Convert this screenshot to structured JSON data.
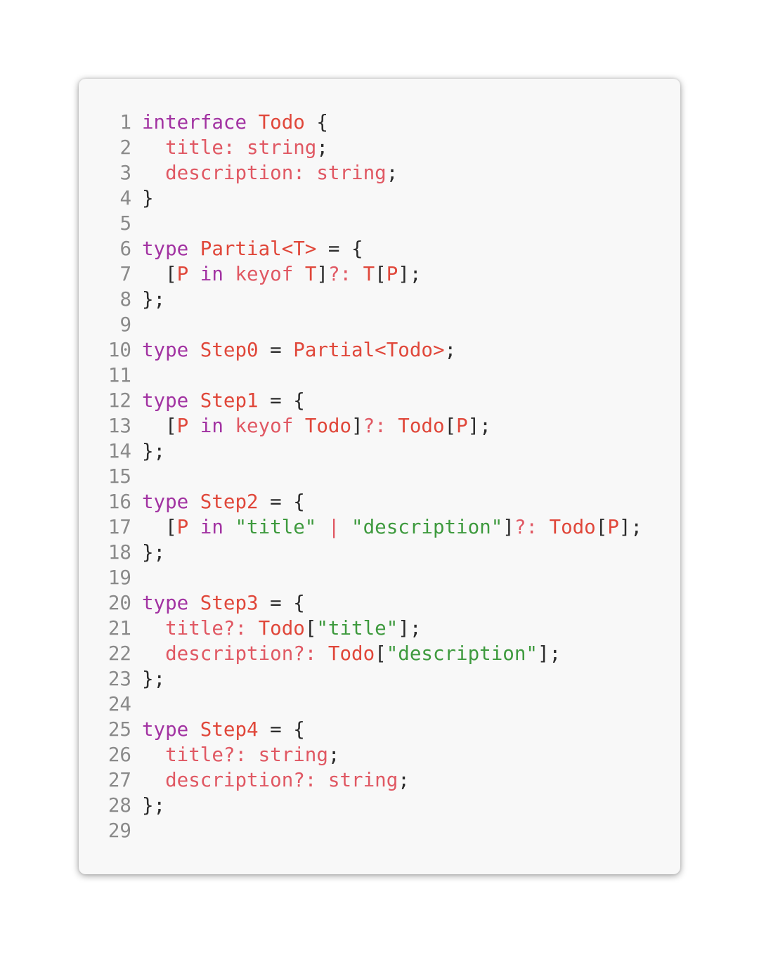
{
  "colors": {
    "card_background": "#f8f8f8",
    "punctuation": "#2b2b2b",
    "keyword": "#a233a2",
    "type_name": "#e0473a",
    "property": "#e05863",
    "string": "#3e9a3e",
    "line_number": "#8a8a8a"
  },
  "code": {
    "language": "typescript",
    "lines": [
      {
        "n": "1",
        "tokens": [
          {
            "t": "kw",
            "v": "interface "
          },
          {
            "t": "ty",
            "v": "Todo"
          },
          {
            "t": "p",
            "v": " {"
          }
        ]
      },
      {
        "n": "2",
        "tokens": [
          {
            "t": "p",
            "v": "  "
          },
          {
            "t": "pr",
            "v": "title: string"
          },
          {
            "t": "p",
            "v": ";"
          }
        ]
      },
      {
        "n": "3",
        "tokens": [
          {
            "t": "p",
            "v": "  "
          },
          {
            "t": "pr",
            "v": "description: string"
          },
          {
            "t": "p",
            "v": ";"
          }
        ]
      },
      {
        "n": "4",
        "tokens": [
          {
            "t": "p",
            "v": "}"
          }
        ]
      },
      {
        "n": "5",
        "tokens": []
      },
      {
        "n": "6",
        "tokens": [
          {
            "t": "kw",
            "v": "type "
          },
          {
            "t": "ty",
            "v": "Partial<T>"
          },
          {
            "t": "p",
            "v": " = {"
          }
        ]
      },
      {
        "n": "7",
        "tokens": [
          {
            "t": "p",
            "v": "  ["
          },
          {
            "t": "ty",
            "v": "P"
          },
          {
            "t": "kw",
            "v": " in "
          },
          {
            "t": "pr",
            "v": "keyof "
          },
          {
            "t": "ty",
            "v": "T"
          },
          {
            "t": "p",
            "v": "]"
          },
          {
            "t": "pr",
            "v": "?: "
          },
          {
            "t": "ty",
            "v": "T"
          },
          {
            "t": "p",
            "v": "["
          },
          {
            "t": "ty",
            "v": "P"
          },
          {
            "t": "p",
            "v": "];"
          }
        ]
      },
      {
        "n": "8",
        "tokens": [
          {
            "t": "p",
            "v": "};"
          }
        ]
      },
      {
        "n": "9",
        "tokens": []
      },
      {
        "n": "10",
        "tokens": [
          {
            "t": "kw",
            "v": "type "
          },
          {
            "t": "ty",
            "v": "Step0"
          },
          {
            "t": "p",
            "v": " = "
          },
          {
            "t": "ty",
            "v": "Partial<Todo>"
          },
          {
            "t": "p",
            "v": ";"
          }
        ]
      },
      {
        "n": "11",
        "tokens": []
      },
      {
        "n": "12",
        "tokens": [
          {
            "t": "kw",
            "v": "type "
          },
          {
            "t": "ty",
            "v": "Step1"
          },
          {
            "t": "p",
            "v": " = {"
          }
        ]
      },
      {
        "n": "13",
        "tokens": [
          {
            "t": "p",
            "v": "  ["
          },
          {
            "t": "ty",
            "v": "P"
          },
          {
            "t": "kw",
            "v": " in "
          },
          {
            "t": "pr",
            "v": "keyof "
          },
          {
            "t": "ty",
            "v": "Todo"
          },
          {
            "t": "p",
            "v": "]"
          },
          {
            "t": "pr",
            "v": "?: "
          },
          {
            "t": "ty",
            "v": "Todo"
          },
          {
            "t": "p",
            "v": "["
          },
          {
            "t": "ty",
            "v": "P"
          },
          {
            "t": "p",
            "v": "];"
          }
        ]
      },
      {
        "n": "14",
        "tokens": [
          {
            "t": "p",
            "v": "};"
          }
        ]
      },
      {
        "n": "15",
        "tokens": []
      },
      {
        "n": "16",
        "tokens": [
          {
            "t": "kw",
            "v": "type "
          },
          {
            "t": "ty",
            "v": "Step2"
          },
          {
            "t": "p",
            "v": " = {"
          }
        ]
      },
      {
        "n": "17",
        "tokens": [
          {
            "t": "p",
            "v": "  ["
          },
          {
            "t": "ty",
            "v": "P"
          },
          {
            "t": "kw",
            "v": " in "
          },
          {
            "t": "st",
            "v": "\"title\""
          },
          {
            "t": "pr",
            "v": " | "
          },
          {
            "t": "st",
            "v": "\"description\""
          },
          {
            "t": "p",
            "v": "]"
          },
          {
            "t": "pr",
            "v": "?: "
          },
          {
            "t": "ty",
            "v": "Todo"
          },
          {
            "t": "p",
            "v": "["
          },
          {
            "t": "ty",
            "v": "P"
          },
          {
            "t": "p",
            "v": "];"
          }
        ]
      },
      {
        "n": "18",
        "tokens": [
          {
            "t": "p",
            "v": "};"
          }
        ]
      },
      {
        "n": "19",
        "tokens": []
      },
      {
        "n": "20",
        "tokens": [
          {
            "t": "kw",
            "v": "type "
          },
          {
            "t": "ty",
            "v": "Step3"
          },
          {
            "t": "p",
            "v": " = {"
          }
        ]
      },
      {
        "n": "21",
        "tokens": [
          {
            "t": "p",
            "v": "  "
          },
          {
            "t": "pr",
            "v": "title?: "
          },
          {
            "t": "ty",
            "v": "Todo"
          },
          {
            "t": "p",
            "v": "["
          },
          {
            "t": "st",
            "v": "\"title\""
          },
          {
            "t": "p",
            "v": "];"
          }
        ]
      },
      {
        "n": "22",
        "tokens": [
          {
            "t": "p",
            "v": "  "
          },
          {
            "t": "pr",
            "v": "description?: "
          },
          {
            "t": "ty",
            "v": "Todo"
          },
          {
            "t": "p",
            "v": "["
          },
          {
            "t": "st",
            "v": "\"description\""
          },
          {
            "t": "p",
            "v": "];"
          }
        ]
      },
      {
        "n": "23",
        "tokens": [
          {
            "t": "p",
            "v": "};"
          }
        ]
      },
      {
        "n": "24",
        "tokens": []
      },
      {
        "n": "25",
        "tokens": [
          {
            "t": "kw",
            "v": "type "
          },
          {
            "t": "ty",
            "v": "Step4"
          },
          {
            "t": "p",
            "v": " = {"
          }
        ]
      },
      {
        "n": "26",
        "tokens": [
          {
            "t": "p",
            "v": "  "
          },
          {
            "t": "pr",
            "v": "title?: string"
          },
          {
            "t": "p",
            "v": ";"
          }
        ]
      },
      {
        "n": "27",
        "tokens": [
          {
            "t": "p",
            "v": "  "
          },
          {
            "t": "pr",
            "v": "description?: string"
          },
          {
            "t": "p",
            "v": ";"
          }
        ]
      },
      {
        "n": "28",
        "tokens": [
          {
            "t": "p",
            "v": "};"
          }
        ]
      },
      {
        "n": "29",
        "tokens": []
      }
    ]
  }
}
